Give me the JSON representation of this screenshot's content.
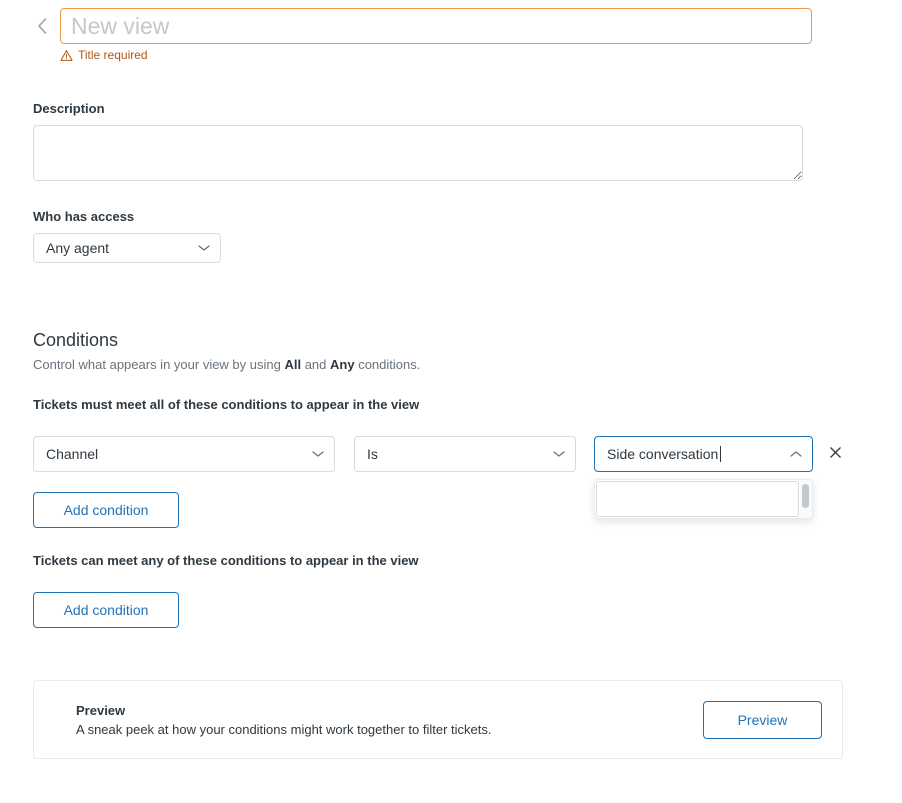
{
  "header": {
    "back_icon": "chevron-left-icon",
    "title_placeholder": "New view",
    "title_value": "",
    "error_icon": "warning-triangle-icon",
    "error_text": "Title required"
  },
  "description": {
    "label": "Description",
    "value": "",
    "placeholder": ""
  },
  "access": {
    "label": "Who has access",
    "selected": "Any agent",
    "caret_icon": "chevron-down-icon"
  },
  "conditions": {
    "title": "Conditions",
    "subtitle_prefix": "Control what appears in your view by using ",
    "subtitle_all": "All",
    "subtitle_mid": " and ",
    "subtitle_any": "Any",
    "subtitle_suffix": " conditions.",
    "all_heading": "Tickets must meet all of these conditions to appear in the view",
    "any_heading": "Tickets can meet any of these conditions to appear in the view",
    "add_condition_label": "Add condition",
    "row": {
      "field": "Channel",
      "field_caret_icon": "chevron-down-icon",
      "operator": "Is",
      "operator_caret_icon": "chevron-down-icon",
      "value": "Side conversation",
      "value_caret_icon": "chevron-up-icon",
      "remove_icon": "close-icon",
      "dropdown_open": true,
      "dropdown_options": []
    }
  },
  "preview": {
    "title": "Preview",
    "description": "A sneak peek at how your conditions might work together to filter tickets.",
    "button_label": "Preview"
  },
  "colors": {
    "accent_blue": "#1f73b7",
    "warning_orange": "#ed9c44",
    "warning_text": "#ad5918",
    "text_primary": "#2f3941",
    "text_secondary": "#68737d",
    "border": "#d8dcde"
  }
}
